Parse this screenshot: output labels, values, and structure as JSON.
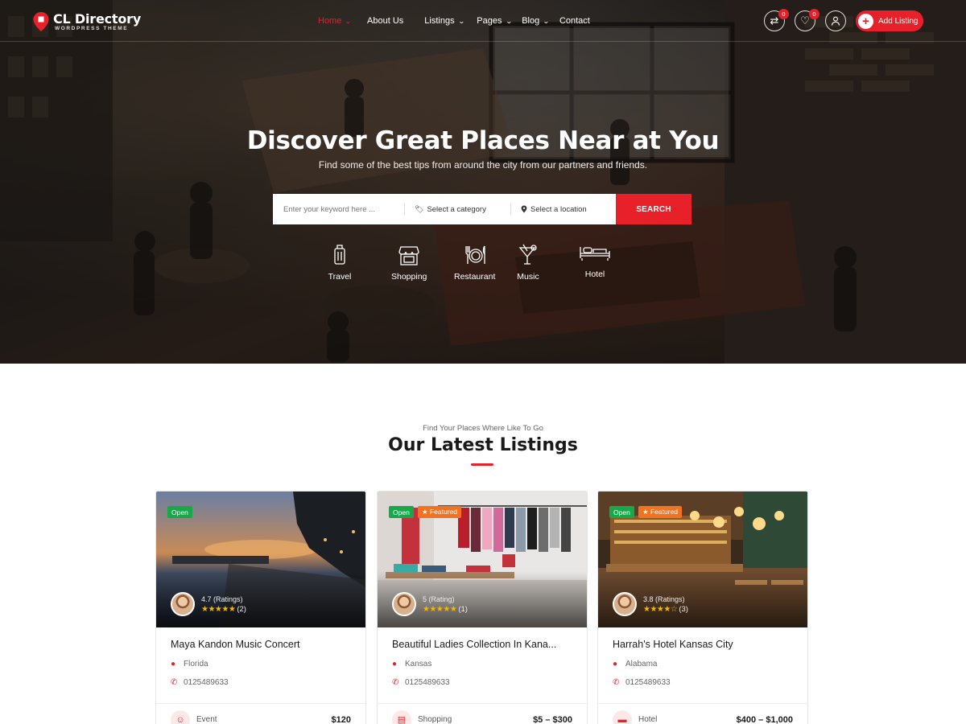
{
  "brand": {
    "title": "CL Directory",
    "subtitle": "WORDPRESS THEME"
  },
  "nav": {
    "items": [
      {
        "label": "Home",
        "dropdown": true,
        "active": true
      },
      {
        "label": "About Us",
        "dropdown": false,
        "active": false
      },
      {
        "label": "Listings",
        "dropdown": true,
        "active": false
      },
      {
        "label": "Pages",
        "dropdown": true,
        "active": false
      },
      {
        "label": "Blog",
        "dropdown": true,
        "active": false
      },
      {
        "label": "Contact",
        "dropdown": false,
        "active": false
      }
    ],
    "compare_count": "0",
    "wishlist_count": "0",
    "add_listing": "Add Listing"
  },
  "hero": {
    "title": "Discover Great Places Near at You",
    "subtitle": "Find some of the best tips from around the city from our partners and friends.",
    "search": {
      "keyword_placeholder": "Enter your keyword here ...",
      "category": "Select a category",
      "location": "Select a location",
      "button": "SEARCH"
    },
    "categories": [
      {
        "label": "Travel",
        "icon": "luggage-icon"
      },
      {
        "label": "Shopping",
        "icon": "store-icon"
      },
      {
        "label": "Restaurant",
        "icon": "dining-icon"
      },
      {
        "label": "Music",
        "icon": "cocktail-icon"
      },
      {
        "label": "Hotel",
        "icon": "bed-icon"
      }
    ]
  },
  "section": {
    "kicker": "Find Your Places Where Like To Go",
    "title": "Our Latest Listings"
  },
  "listings": [
    {
      "open": "Open",
      "featured": "",
      "rating_label": "4.7 (Ratings)",
      "stars": "★★★★★",
      "count": "(2)",
      "title": "Maya Kandon Music Concert",
      "location": "Florida",
      "phone": "0125489633",
      "category": "Event",
      "price": "$120"
    },
    {
      "open": "Open",
      "featured": "★ Featured",
      "rating_label": "5 (Rating)",
      "stars": "★★★★★",
      "count": "(1)",
      "title": "Beautiful Ladies Collection In Kana...",
      "location": "Kansas",
      "phone": "0125489633",
      "category": "Shopping",
      "price": "$5 – $300"
    },
    {
      "open": "Open",
      "featured": "★ Featured",
      "rating_label": "3.8 (Ratings)",
      "stars": "★★★★☆",
      "count": "(3)",
      "title": "Harrah's Hotel Kansas City",
      "location": "Alabama",
      "phone": "0125489633",
      "category": "Hotel",
      "price": "$400 – $1,000"
    }
  ],
  "colors": {
    "accent": "#e8202a",
    "open": "#17a84a",
    "featured": "#f3721f",
    "star": "#f5b700"
  }
}
